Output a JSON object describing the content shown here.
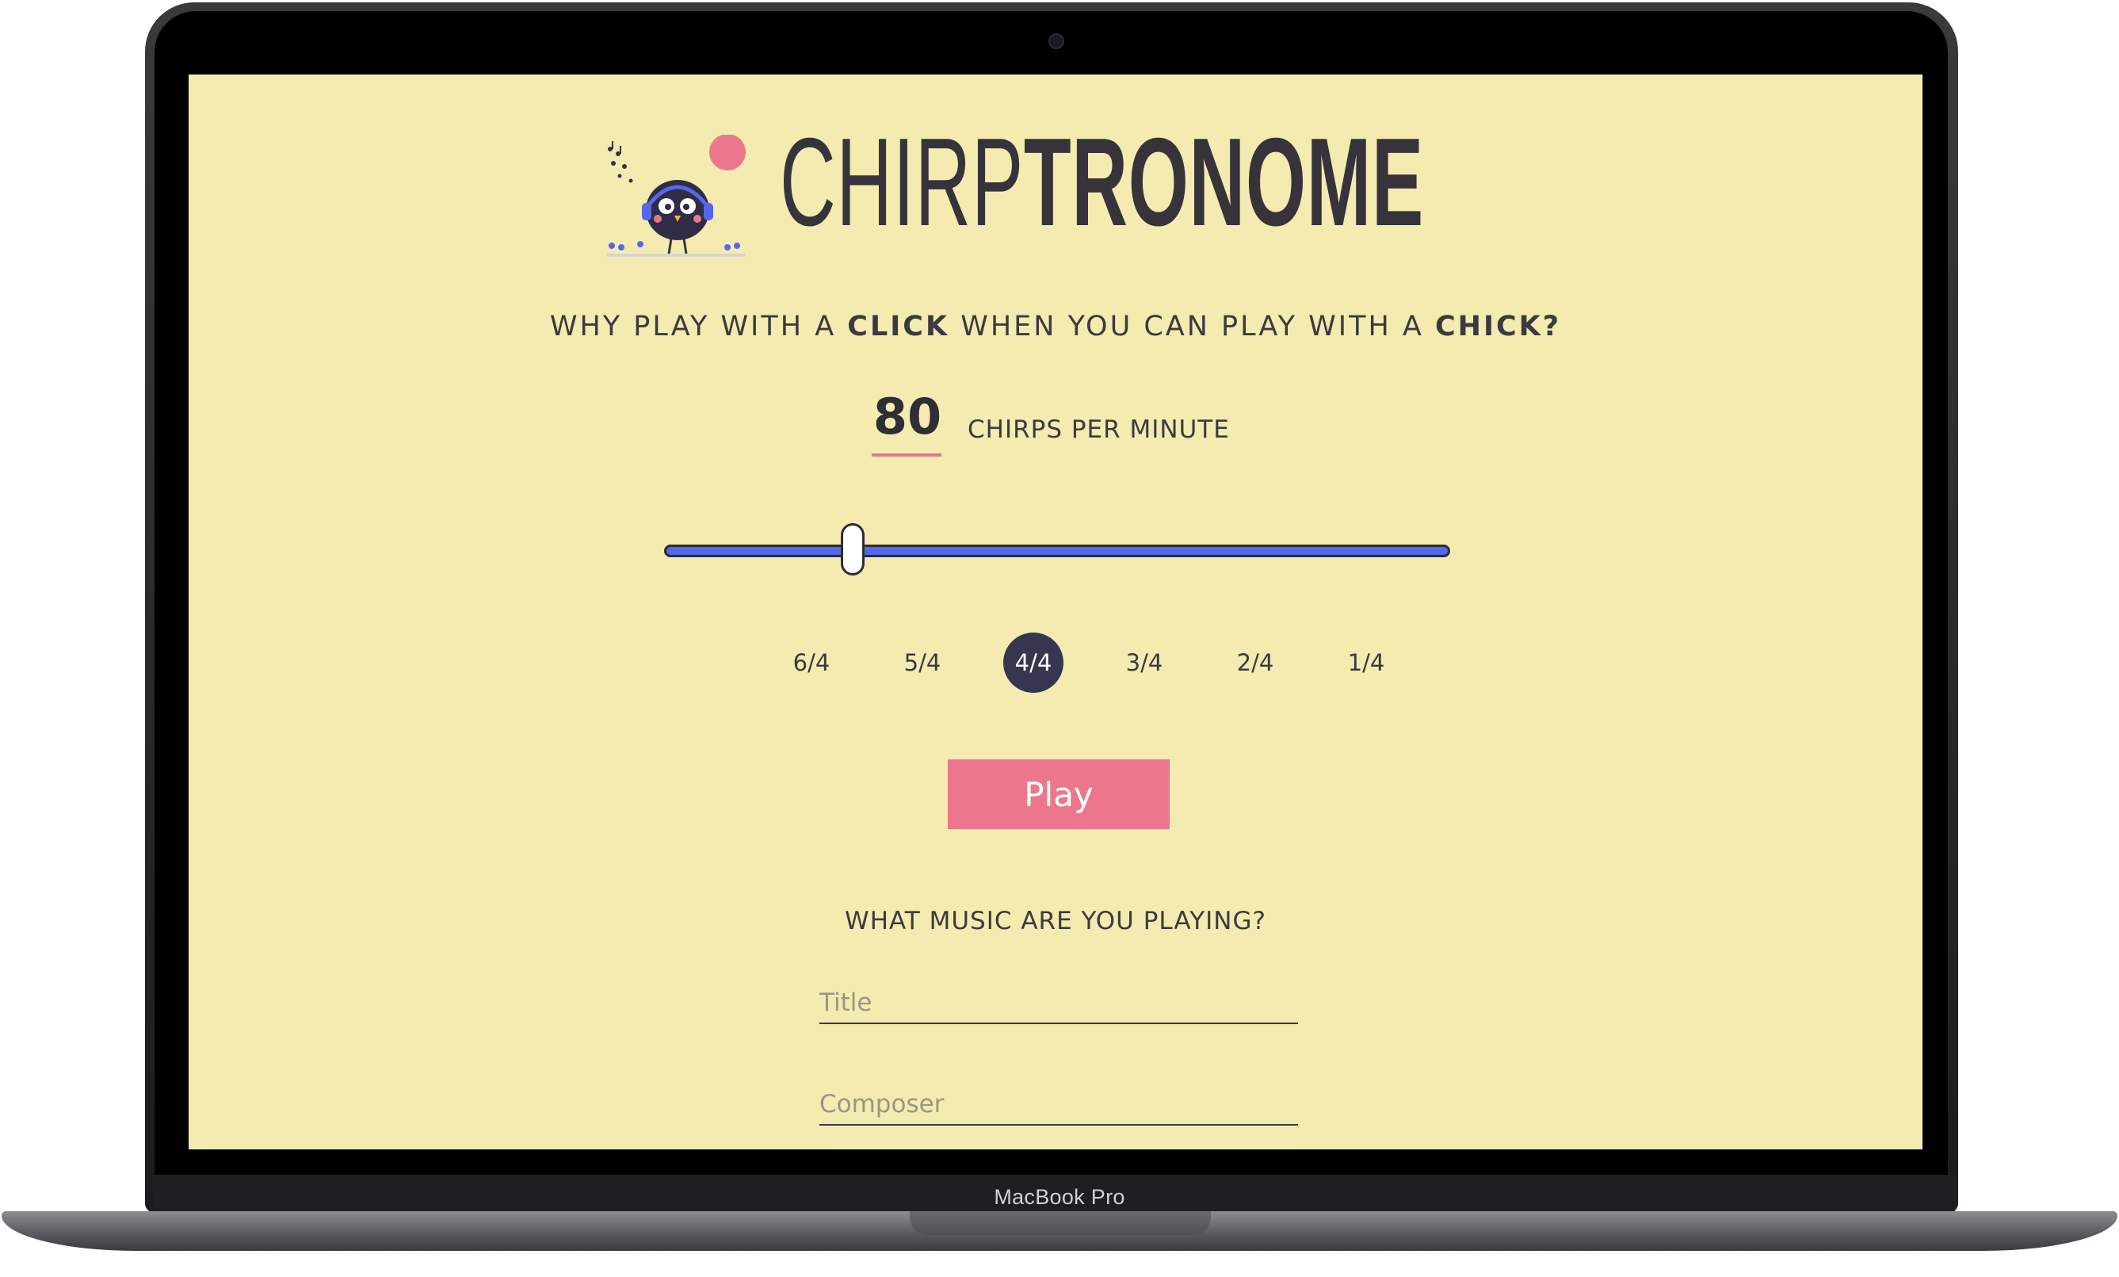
{
  "device": {
    "label": "MacBook Pro"
  },
  "app": {
    "title_light": "CHIRP",
    "title_bold": "TRONOME",
    "tagline": {
      "part1": "WHY PLAY WITH A ",
      "bold1": "CLICK",
      "part2": " WHEN YOU CAN PLAY WITH A ",
      "bold2": "CHICK?"
    },
    "tempo": {
      "value": "80",
      "unit_label": "CHIRPS PER MINUTE"
    },
    "slider": {
      "fraction": 0.24
    },
    "time_signatures": [
      {
        "label": "6/4",
        "active": false
      },
      {
        "label": "5/4",
        "active": false
      },
      {
        "label": "4/4",
        "active": true
      },
      {
        "label": "3/4",
        "active": false
      },
      {
        "label": "2/4",
        "active": false
      },
      {
        "label": "1/4",
        "active": false
      }
    ],
    "play_label": "Play",
    "music_question": "WHAT MUSIC ARE YOU PLAYING?",
    "fields": {
      "title_placeholder": "Title",
      "composer_placeholder": "Composer"
    }
  },
  "colors": {
    "background": "#f4ebb0",
    "accent_pink": "#ec778d",
    "slider_blue": "#5668ea",
    "dark": "#363650"
  }
}
